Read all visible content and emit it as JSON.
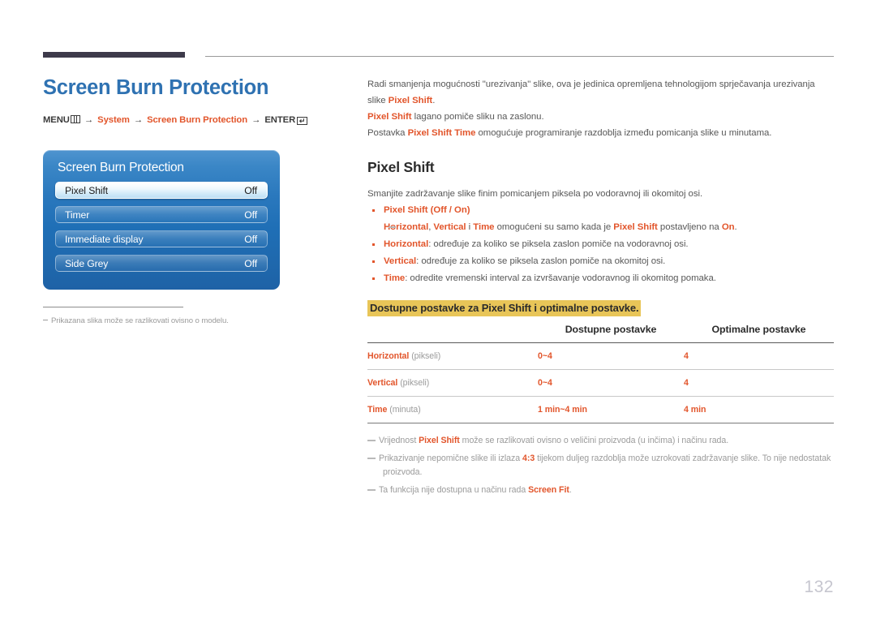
{
  "page": {
    "number": "132"
  },
  "header": {
    "title": "Screen Burn Protection",
    "menu_path": {
      "menu_label": "MENU",
      "menu_icon": "menu-bars-icon",
      "arrow": "→",
      "item1": "System",
      "item2": "Screen Burn Protection",
      "enter_label": "ENTER",
      "enter_icon": "enter-return-icon",
      "enter_glyph": "↵"
    }
  },
  "osd": {
    "title": "Screen Burn Protection",
    "rows": [
      {
        "label": "Pixel Shift",
        "value": "Off",
        "selected": true
      },
      {
        "label": "Timer",
        "value": "Off",
        "selected": false
      },
      {
        "label": "Immediate display",
        "value": "Off",
        "selected": false
      },
      {
        "label": "Side Grey",
        "value": "Off",
        "selected": false
      }
    ]
  },
  "left_caption": {
    "text": "Prikazana slika može se razlikovati ovisno o modelu."
  },
  "intro": {
    "p1_a": "Radi smanjenja mogućnosti \"urezivanja\" slike, ova je jedinica opremljena tehnologijom sprječavanja urezivanja slike ",
    "p1_b": "Pixel Shift",
    "p1_c": ".",
    "p2_a": "Pixel Shift",
    "p2_b": " lagano pomiče sliku na zaslonu.",
    "p3_a": "Postavka ",
    "p3_b": "Pixel Shift Time",
    "p3_c": " omogućuje programiranje razdoblja između pomicanja slike u minutama."
  },
  "section": {
    "title": "Pixel Shift",
    "lead": "Smanjite zadržavanje slike finim pomicanjem piksela po vodoravnoj ili okomitoj osi.",
    "bullets": [
      {
        "key": "Pixel Shift",
        "rest_a": " (",
        "opt1": "Off",
        "sep": " / ",
        "opt2": "On",
        "rest_b": ")"
      },
      {
        "key": "Horizontal",
        "rest": ": određuje za koliko se piksela zaslon pomiče na vodoravnoj osi."
      },
      {
        "key": "Vertical",
        "rest": ": određuje za koliko se piksela zaslon pomiče na okomitoj osi."
      },
      {
        "key": "Time",
        "rest": ": odredite vremenski interval za izvršavanje vodoravnog ili okomitog pomaka."
      }
    ],
    "note": {
      "k1": "Horizontal",
      "t1": ", ",
      "k2": "Vertical",
      "t2": " i ",
      "k3": "Time",
      "t3": " omogućeni su samo kada je ",
      "k4": "Pixel Shift",
      "t4": " postavljeno na ",
      "k5": "On",
      "t5": "."
    }
  },
  "table": {
    "highlight_heading": "Dostupne postavke za Pixel Shift i optimalne postavke.",
    "headers": [
      "",
      "Dostupne postavke",
      "Optimalne postavke"
    ],
    "rows": [
      {
        "key": "Horizontal",
        "unit": " (pikseli)",
        "available": "0~4",
        "optimal": "4"
      },
      {
        "key": "Vertical",
        "unit": " (pikseli)",
        "available": "0~4",
        "optimal": "4"
      },
      {
        "key": "Time",
        "unit": " (minuta)",
        "available": "1 min~4 min",
        "optimal": "4 min"
      }
    ]
  },
  "footnotes": [
    {
      "a": "Vrijednost ",
      "k": "Pixel Shift",
      "b": " može se razlikovati ovisno o veličini proizvoda (u inčima) i načinu rada."
    },
    {
      "a": "Prikazivanje nepomične slike ili izlaza ",
      "k": "4:3",
      "b": " tijekom duljeg razdoblja može uzrokovati zadržavanje slike. To nije nedostatak",
      "c": "proizvoda."
    },
    {
      "a": "Ta funkcija nije dostupna u načinu rada ",
      "k": "Screen Fit",
      "b": "."
    }
  ],
  "colors": {
    "accent_orange": "#e2552b",
    "title_blue": "#2f72b2",
    "highlight_yellow": "#e8c558",
    "osd_blue": "#1f6fb6",
    "rule_dark": "#3d3a4a"
  }
}
